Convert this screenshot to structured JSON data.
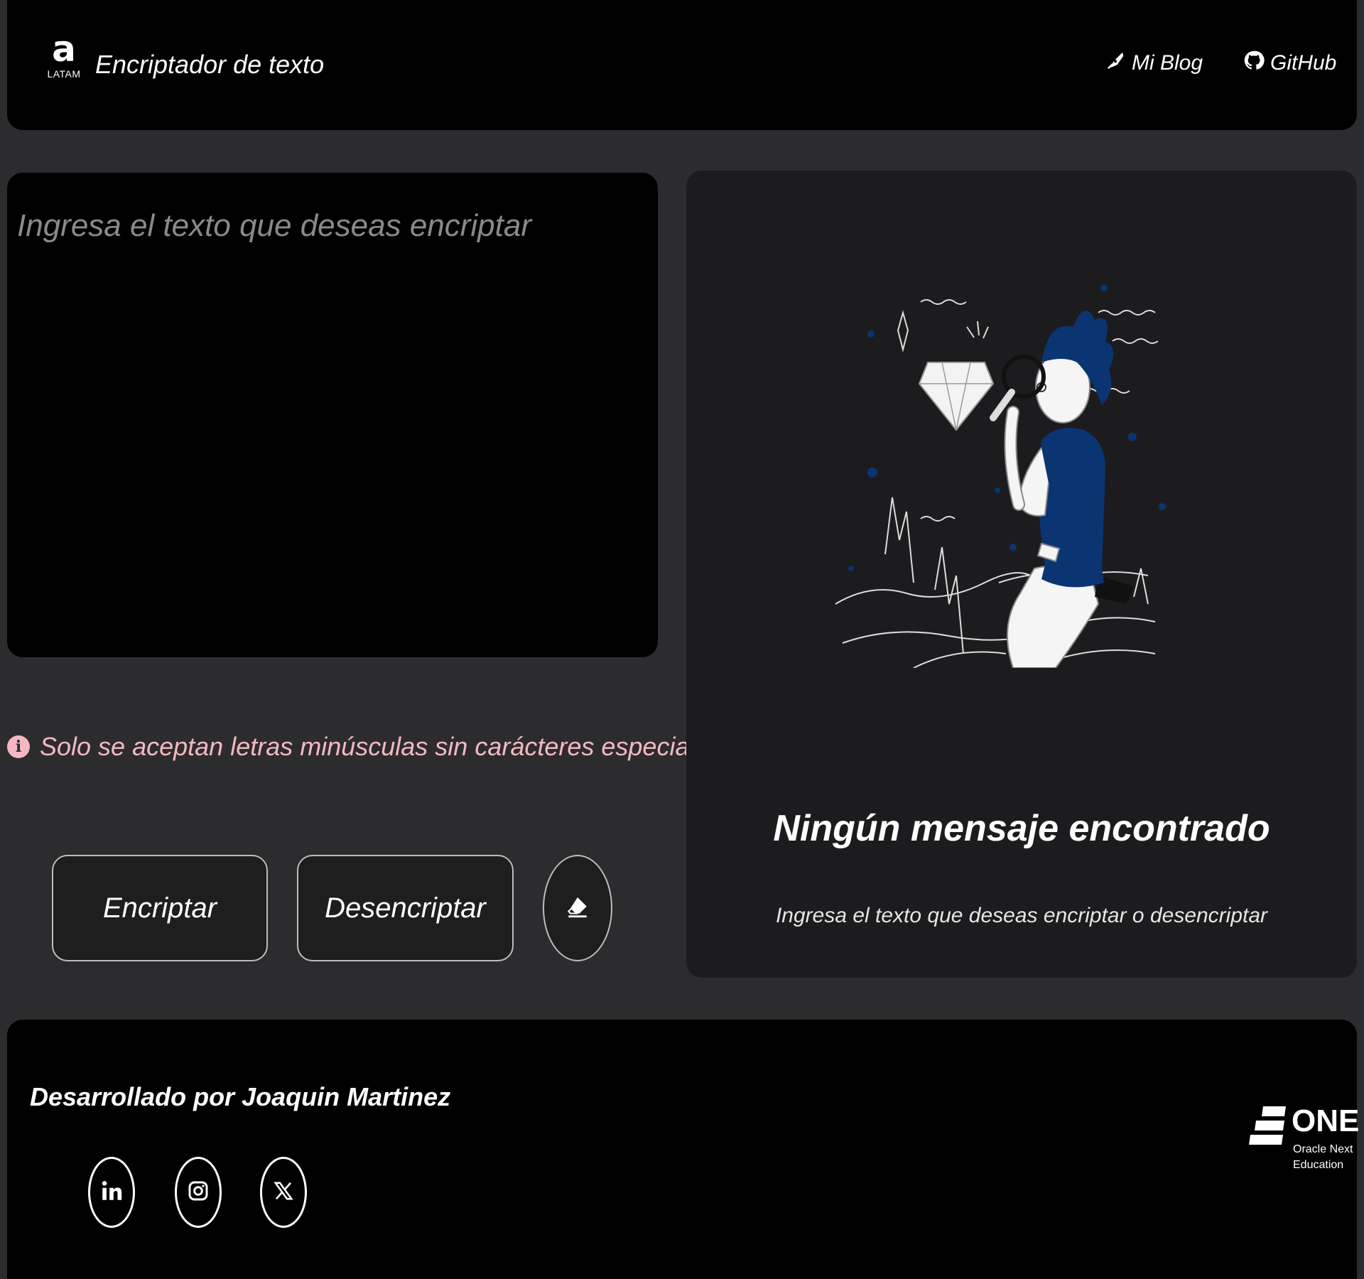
{
  "header": {
    "logo_text": "LATAM",
    "title": "Encriptador de texto",
    "nav": [
      {
        "label": "Mi Blog",
        "icon": "pen-nib-icon"
      },
      {
        "label": "GitHub",
        "icon": "github-icon"
      }
    ]
  },
  "input": {
    "placeholder": "Ingresa el texto que deseas encriptar",
    "value": ""
  },
  "warning": {
    "icon": "info-icon",
    "text": "Solo se aceptan letras minúsculas sin carácteres especiales"
  },
  "actions": {
    "encrypt_label": "Encriptar",
    "decrypt_label": "Desencriptar",
    "clear_icon": "eraser-icon"
  },
  "output": {
    "title": "Ningún mensaje encontrado",
    "subtitle": "Ingresa el texto que deseas encriptar o desencriptar"
  },
  "footer": {
    "credit": "Desarrollado por Joaquin Martinez",
    "social": [
      "linkedin-icon",
      "instagram-icon",
      "x-icon"
    ],
    "brand": {
      "name": "ONE",
      "tagline": "Oracle Next Education"
    }
  },
  "colors": {
    "page_bg": "#2c2c2e",
    "panel_bg": "#000000",
    "output_bg": "#1c1c1e",
    "warning": "#f5b8c2",
    "accent_blue": "#0b3472"
  }
}
